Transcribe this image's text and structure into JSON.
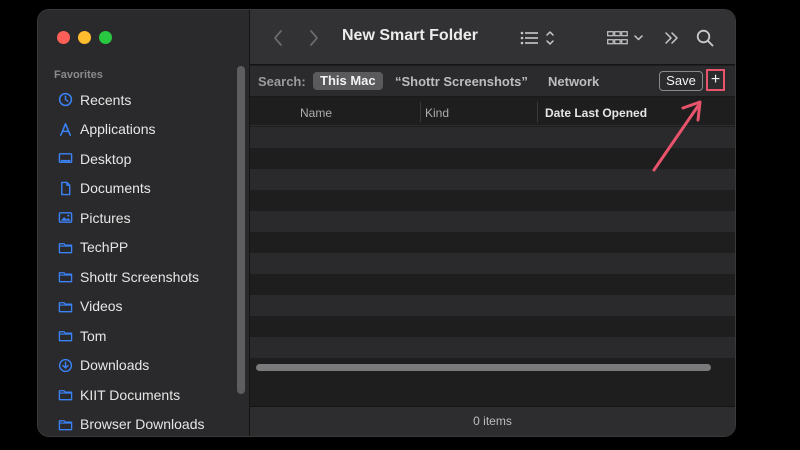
{
  "window": {
    "title": "New Smart Folder"
  },
  "sidebar": {
    "section_header": "Favorites",
    "items": [
      {
        "label": "Recents",
        "icon": "clock-icon"
      },
      {
        "label": "Applications",
        "icon": "applications-icon"
      },
      {
        "label": "Desktop",
        "icon": "desktop-icon"
      },
      {
        "label": "Documents",
        "icon": "document-icon"
      },
      {
        "label": "Pictures",
        "icon": "pictures-icon"
      },
      {
        "label": "TechPP",
        "icon": "folder-icon"
      },
      {
        "label": "Shottr Screenshots",
        "icon": "folder-icon"
      },
      {
        "label": "Videos",
        "icon": "folder-icon"
      },
      {
        "label": "Tom",
        "icon": "folder-icon"
      },
      {
        "label": "Downloads",
        "icon": "download-icon"
      },
      {
        "label": "KIIT Documents",
        "icon": "folder-icon"
      },
      {
        "label": "Browser Downloads",
        "icon": "folder-icon"
      }
    ]
  },
  "search": {
    "label": "Search:",
    "scopes": [
      "This Mac",
      "“Shottr Screenshots”",
      "Network"
    ],
    "active_scope": "This Mac",
    "save_label": "Save",
    "add_label": "+"
  },
  "columns": [
    "Name",
    "Kind",
    "Date Last Opened"
  ],
  "status": {
    "items_text": "0 items"
  },
  "colors": {
    "accent": "#3b82f6",
    "highlight": "#e8546b"
  }
}
